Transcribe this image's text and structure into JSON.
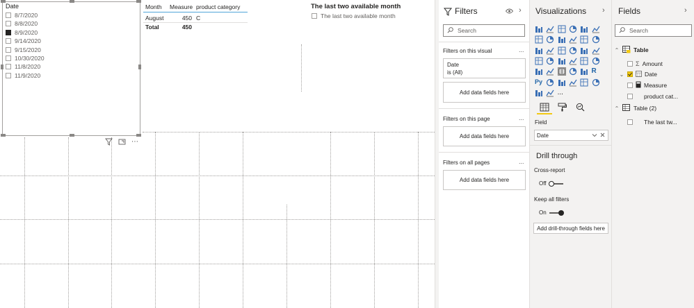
{
  "slicer": {
    "title": "Date",
    "items": [
      {
        "label": "8/7/2020",
        "checked": false
      },
      {
        "label": "8/8/2020",
        "checked": false
      },
      {
        "label": "8/9/2020",
        "checked": true
      },
      {
        "label": "9/14/2020",
        "checked": false
      },
      {
        "label": "9/15/2020",
        "checked": false
      },
      {
        "label": "10/30/2020",
        "checked": false
      },
      {
        "label": "11/8/2020",
        "checked": false
      },
      {
        "label": "11/9/2020",
        "checked": false
      }
    ]
  },
  "table_visual": {
    "headers": [
      "Month",
      "Measure",
      "product category"
    ],
    "rows": [
      [
        "August",
        "450",
        "C"
      ]
    ],
    "total": {
      "label": "Total",
      "value": "450",
      "category": ""
    }
  },
  "slicer2": {
    "title": "The last two available month",
    "item": "The last two available month"
  },
  "filters_pane": {
    "title": "Filters",
    "search_placeholder": "Search",
    "on_visual_label": "Filters on this visual",
    "date_card_title": "Date",
    "date_card_value": "is (All)",
    "add_fields_visual": "Add data fields here",
    "on_page_label": "Filters on this page",
    "add_fields_page": "Add data fields here",
    "all_pages_label": "Filters on all pages",
    "add_fields_all": "Add data fields here",
    "more": "..."
  },
  "viz_pane": {
    "title": "Visualizations",
    "field_label": "Field",
    "field_value": "Date",
    "drill_title": "Drill through",
    "cross_report_label": "Cross-report",
    "cross_report_state": "Off",
    "keep_filters_label": "Keep all filters",
    "keep_filters_state": "On",
    "add_drill": "Add drill-through fields here",
    "r_letter": "R",
    "py_letter": "Py",
    "more": "..."
  },
  "fields_pane": {
    "title": "Fields",
    "search_placeholder": "Search",
    "table1": "Table",
    "fields": [
      "Amount",
      "Date",
      "Measure",
      "product cat..."
    ],
    "table2": "Table (2)",
    "table2_fields": [
      "The last tw..."
    ]
  },
  "colors": {
    "accent": "#f2c811",
    "table_underline": "#4fa5d8",
    "pane_bg": "#f3f2f1"
  }
}
